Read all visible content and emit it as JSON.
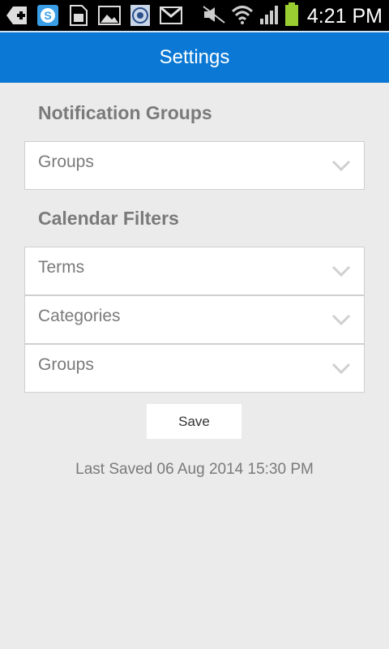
{
  "status_bar": {
    "time": "4:21 PM",
    "icons": [
      "add-notification-icon",
      "skype-icon",
      "sd-card-icon",
      "image-icon",
      "seal-icon",
      "gmail-icon",
      "mute-icon",
      "wifi-icon",
      "signal-icon",
      "battery-icon"
    ],
    "battery_color": "#9acd32"
  },
  "app_bar": {
    "title": "Settings",
    "color": "#0a78d4"
  },
  "notification_groups": {
    "heading": "Notification Groups",
    "selects": [
      {
        "label": "Groups"
      }
    ]
  },
  "calendar_filters": {
    "heading": "Calendar Filters",
    "selects": [
      {
        "label": "Terms"
      },
      {
        "label": "Categories"
      },
      {
        "label": "Groups"
      }
    ]
  },
  "save_button": {
    "label": "Save"
  },
  "last_saved": "Last Saved 06 Aug 2014 15:30 PM"
}
